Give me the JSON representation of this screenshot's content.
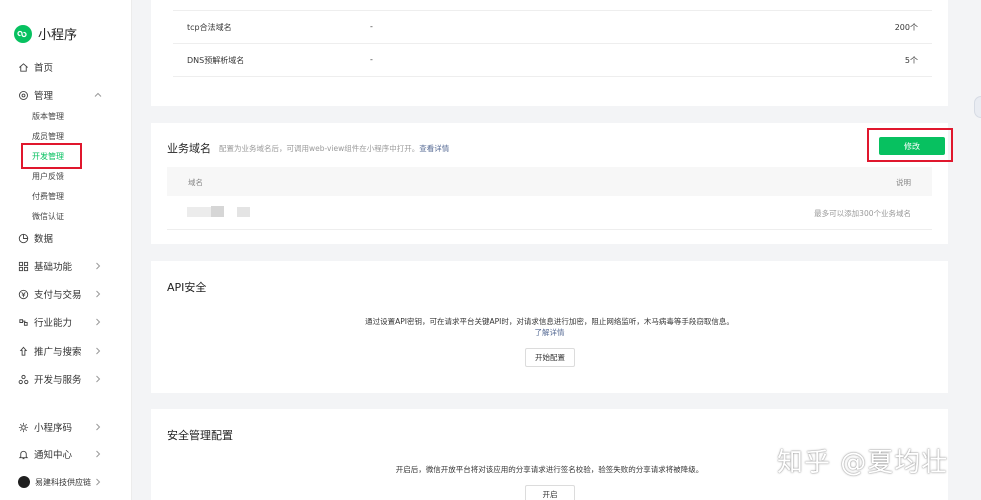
{
  "app": {
    "name": "小程序"
  },
  "sidebar": {
    "home": "首页",
    "manage": "管理",
    "manage_sub": [
      "版本管理",
      "成员管理",
      "开发管理",
      "用户反馈",
      "付费管理",
      "微信认证"
    ],
    "data": "数据",
    "basic": "基础功能",
    "payment": "支付与交易",
    "industry": "行业能力",
    "promo": "推广与搜索",
    "devservice": "开发与服务",
    "qrcode": "小程序码",
    "notify": "通知中心",
    "account": "易建科技供应链"
  },
  "server_domains": {
    "rows": [
      {
        "name": "tcp合法域名",
        "value": "-",
        "limit": "200个"
      },
      {
        "name": "DNS预解析域名",
        "value": "-",
        "limit": "5个"
      }
    ]
  },
  "business_domain": {
    "title": "业务域名",
    "desc": "配置为业务域名后，可调用web-view组件在小程序中打开。",
    "detail_link": "查看详情",
    "edit_button": "修改",
    "col_domain": "域名",
    "col_note": "说明",
    "note": "最多可以添加300个业务域名"
  },
  "api_security": {
    "title": "API安全",
    "desc": "通过设置API密钥，可在请求平台关键API时，对请求信息进行加密，阻止网络监听，木马病毒等手段窃取信息。",
    "learn_more": "了解详情",
    "start_button": "开始配置"
  },
  "security_config": {
    "title": "安全管理配置",
    "desc": "开启后，微信开放平台将对该应用的分享请求进行签名校验，验签失败的分享请求将被降级。",
    "enable_button": "开启"
  },
  "watermark": "知乎 @夏均壮",
  "colors": {
    "brand_green": "#07c160",
    "highlight_red": "#e0172d",
    "link_blue": "#576b95"
  }
}
